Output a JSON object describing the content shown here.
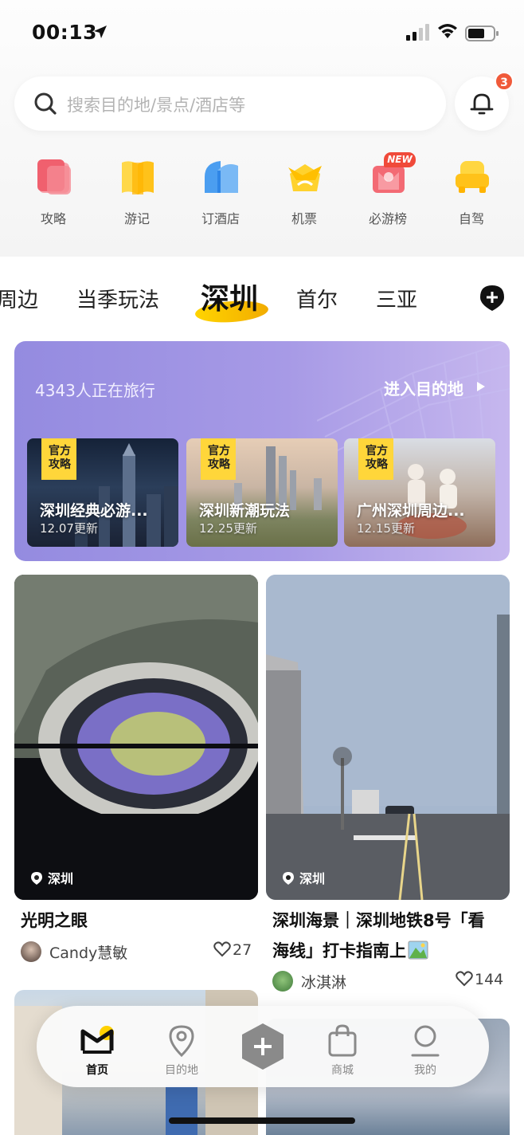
{
  "status_bar": {
    "time": "00:13"
  },
  "search": {
    "placeholder": "搜索目的地/景点/酒店等"
  },
  "notifications": {
    "count": "3"
  },
  "quick_actions": [
    {
      "label": "攻略",
      "icon": "guide-icon",
      "color": "#f0606e"
    },
    {
      "label": "游记",
      "icon": "travelogue-icon",
      "color": "#ffcf2e"
    },
    {
      "label": "订酒店",
      "icon": "hotel-icon",
      "color": "#4ea2ef"
    },
    {
      "label": "机票",
      "icon": "flight-icon",
      "color": "#ffd22e"
    },
    {
      "label": "必游榜",
      "icon": "ranking-icon",
      "color": "#f36a74",
      "badge": "NEW"
    },
    {
      "label": "自驾",
      "icon": "self-drive-icon",
      "color": "#ffc92a"
    }
  ],
  "tabs": [
    "周边",
    "当季玩法",
    "深圳",
    "首尔",
    "三亚"
  ],
  "active_tab": "深圳",
  "banner": {
    "count_text": "4343人正在旅行",
    "enter_label": "进入目的地",
    "cards": [
      {
        "badge": "官方攻略",
        "title": "深圳经典必游...",
        "updated": "12.07更新"
      },
      {
        "badge": "官方攻略",
        "title": "深圳新潮玩法",
        "updated": "12.25更新"
      },
      {
        "badge": "官方攻略",
        "title": "广州深圳周边...",
        "updated": "12.15更新"
      }
    ]
  },
  "feed": [
    {
      "location": "深圳",
      "title": "光明之眼",
      "author": "Candy慧敏",
      "likes": "27"
    },
    {
      "location": "深圳",
      "title_line1": "深圳海景｜深圳地铁8号「看",
      "title_line2": "海线」打卡指南上",
      "author": "冰淇淋",
      "likes": "144"
    }
  ],
  "bottom_nav": [
    {
      "label": "首页",
      "icon": "home-icon"
    },
    {
      "label": "目的地",
      "icon": "destination-icon"
    },
    {
      "label": "",
      "icon": "publish-icon"
    },
    {
      "label": "商城",
      "icon": "shop-icon"
    },
    {
      "label": "我的",
      "icon": "profile-icon"
    }
  ]
}
